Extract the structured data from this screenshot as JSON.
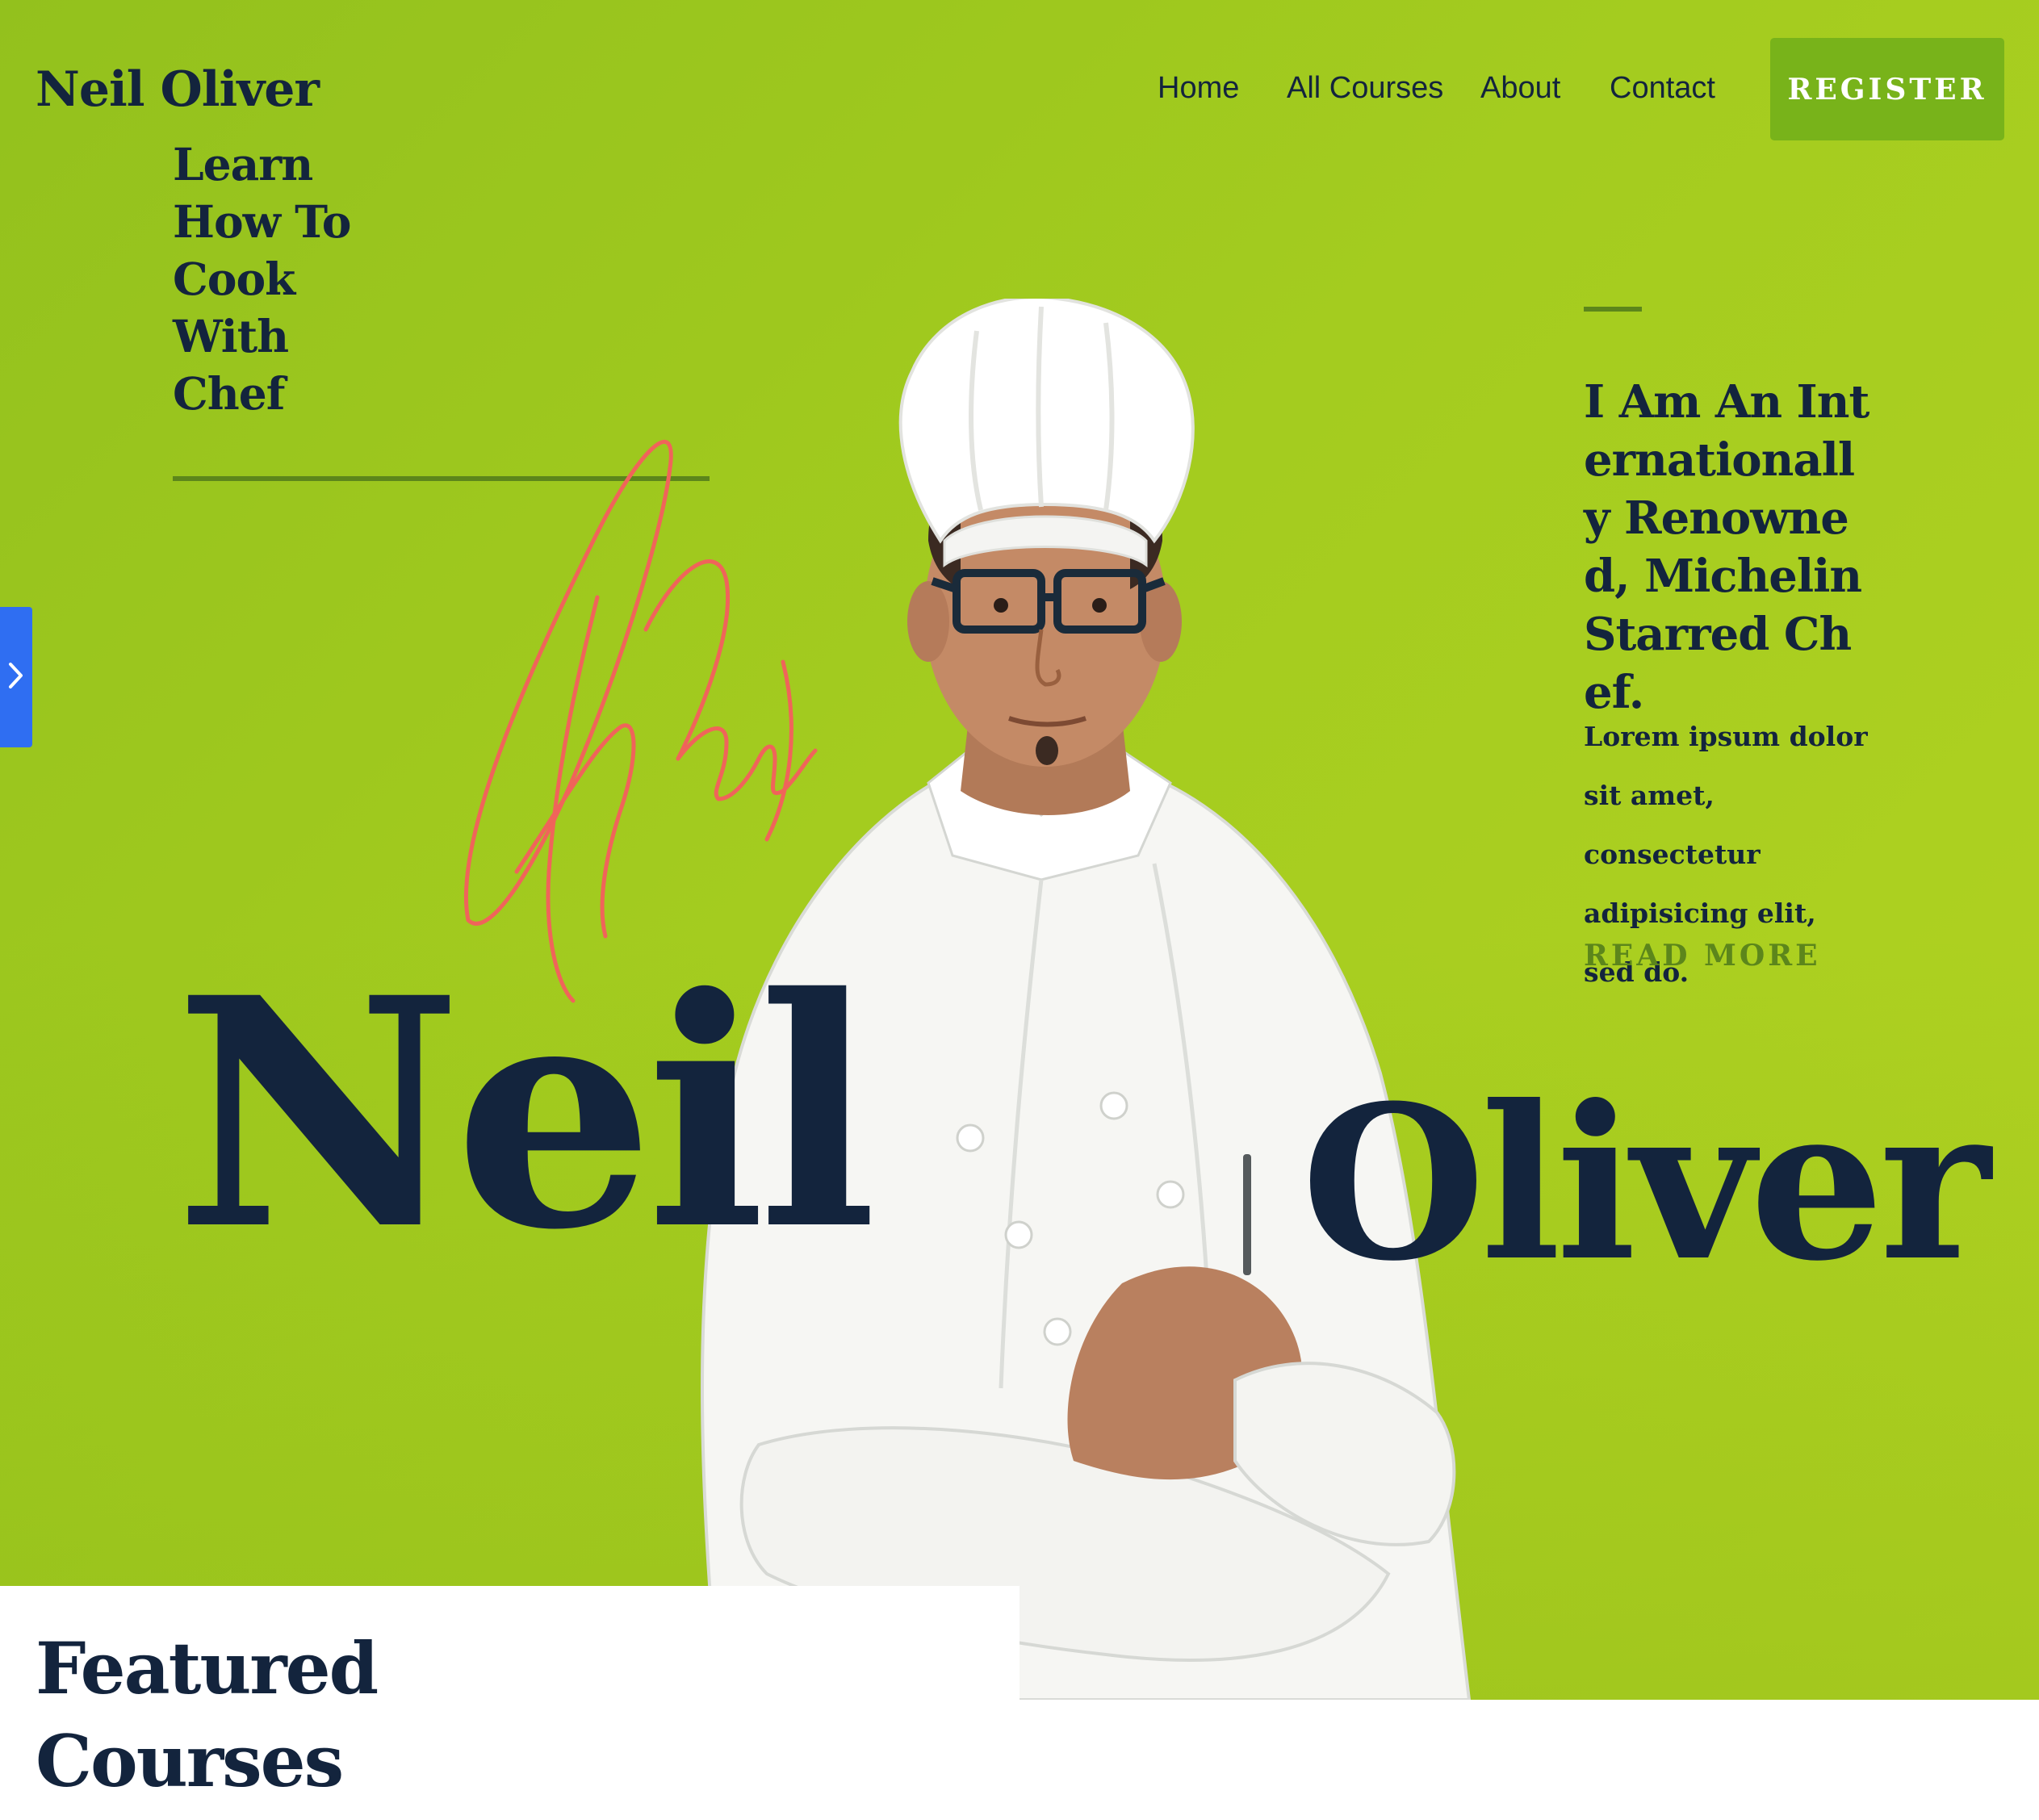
{
  "header": {
    "brand": "Neil Oliver",
    "nav": [
      "Home",
      "All Courses",
      "About",
      "Contact"
    ],
    "register_label": "REGISTER"
  },
  "hero": {
    "tagline": "Learn How To Cook With Chef",
    "first_name": "Neil",
    "last_name": "Oliver",
    "intro_heading": "I Am An Internationally Renowned, Michelin Starred Chef.",
    "intro_body": "Lorem ipsum dolor sit amet, consectetur adipisicing elit, sed do.",
    "read_more": "READ MORE"
  },
  "featured": {
    "title": "Featured Courses"
  },
  "colors": {
    "hero_green": "#a4cc1f",
    "navy_text": "#13243d",
    "register_green": "#78b31a",
    "accent_olive": "#5c861b",
    "signature_coral": "#f0645a",
    "side_tab_blue": "#2f6ef2"
  },
  "icons": {
    "side_tab": "chevron-right-icon"
  }
}
